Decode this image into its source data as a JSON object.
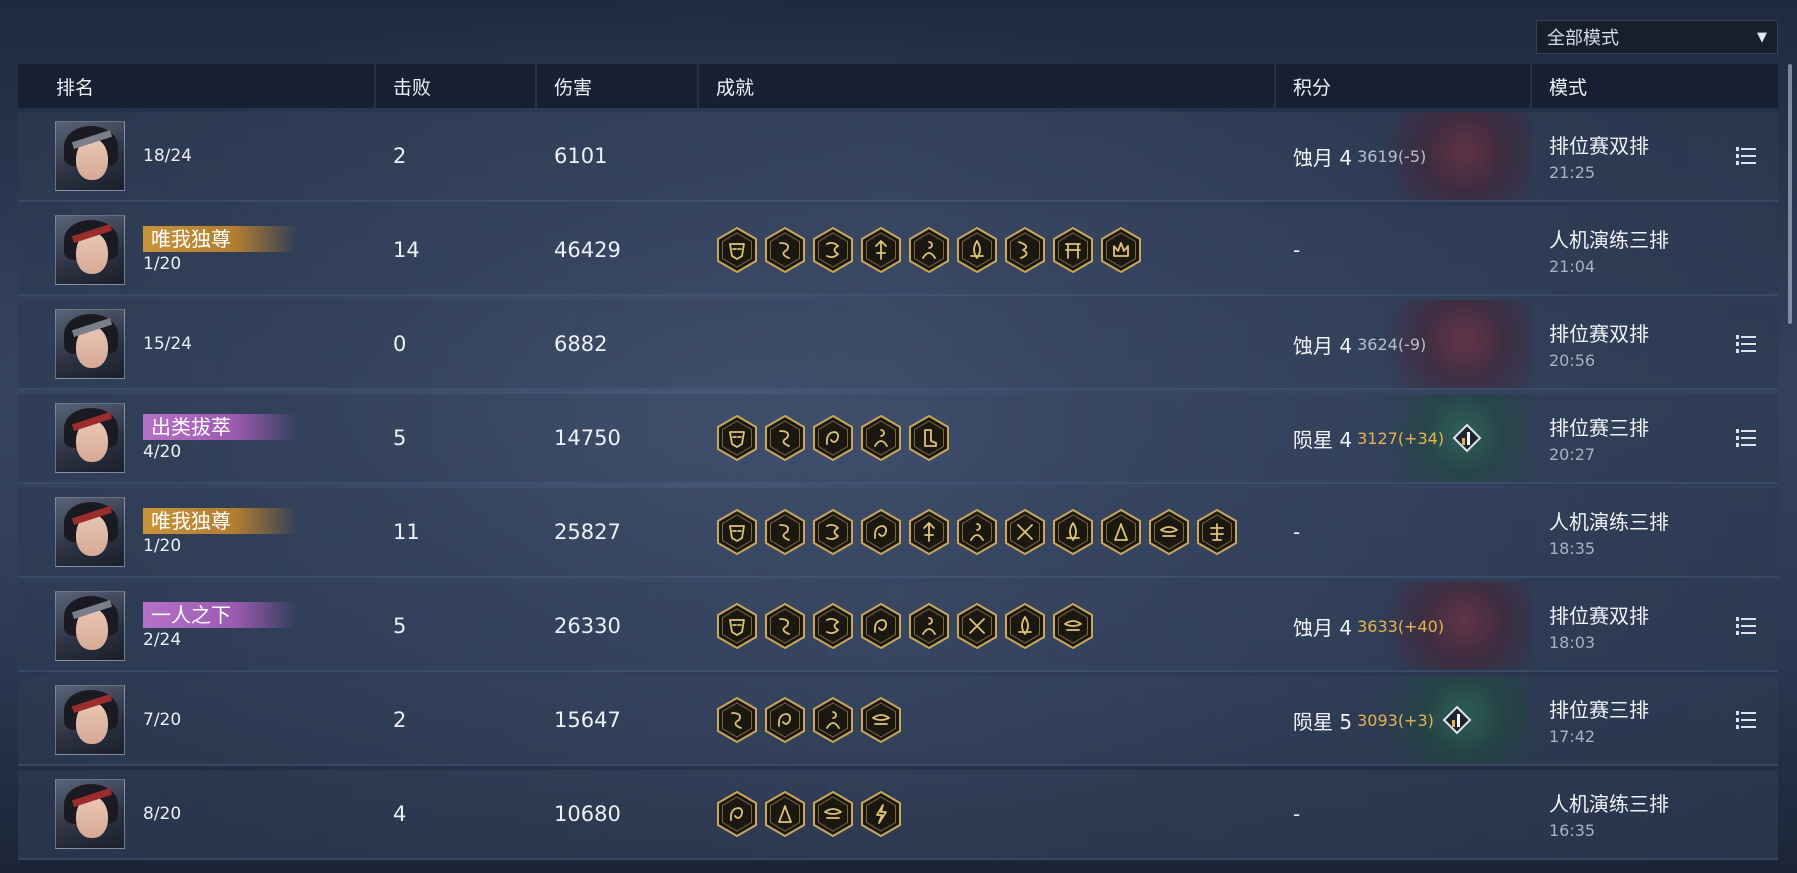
{
  "mode_filter": {
    "selected": "全部模式"
  },
  "headers": {
    "rank": "排名",
    "kills": "击败",
    "damage": "伤害",
    "achievements": "成就",
    "score": "积分",
    "mode": "模式"
  },
  "rows": [
    {
      "avatar": "male",
      "title": "",
      "title_color": "",
      "rank": "18/24",
      "kills": "2",
      "damage": "6101",
      "achievements": [],
      "score_tier": "蚀月 4",
      "score_value": "3619(-5)",
      "score_up": false,
      "score_theme": "red",
      "rank_icon": false,
      "mode_name": "排位赛双排",
      "mode_time": "21:25",
      "has_menu": true
    },
    {
      "avatar": "female",
      "title": "唯我独尊",
      "title_color": "gold",
      "rank": "1/20",
      "kills": "14",
      "damage": "46429",
      "achievements": [
        "mask-icon",
        "snake-icon",
        "dragon-icon",
        "spear-icon",
        "monk-icon",
        "fire-icon",
        "serpent-icon",
        "gate-icon",
        "crown-icon"
      ],
      "score_tier": "-",
      "score_value": "",
      "score_up": false,
      "score_theme": "",
      "rank_icon": false,
      "mode_name": "人机演练三排",
      "mode_time": "21:04",
      "has_menu": false
    },
    {
      "avatar": "male",
      "title": "",
      "title_color": "",
      "rank": "15/24",
      "kills": "0",
      "damage": "6882",
      "achievements": [],
      "score_tier": "蚀月 4",
      "score_value": "3624(-9)",
      "score_up": false,
      "score_theme": "red",
      "rank_icon": false,
      "mode_name": "排位赛双排",
      "mode_time": "20:56",
      "has_menu": true
    },
    {
      "avatar": "female",
      "title": "出类拔萃",
      "title_color": "purple",
      "rank": "4/20",
      "kills": "5",
      "damage": "14750",
      "achievements": [
        "mask-icon",
        "snake-icon",
        "swirl-icon",
        "monk-icon",
        "boot-icon"
      ],
      "score_tier": "陨星 4",
      "score_value": "3127(+34)",
      "score_up": true,
      "score_theme": "green",
      "rank_icon": true,
      "mode_name": "排位赛三排",
      "mode_time": "20:27",
      "has_menu": true
    },
    {
      "avatar": "female",
      "title": "唯我独尊",
      "title_color": "gold",
      "rank": "1/20",
      "kills": "11",
      "damage": "25827",
      "achievements": [
        "mask-icon",
        "snake-icon",
        "dragon-icon",
        "swirl-icon",
        "spear-icon",
        "monk-icon",
        "cross-icon",
        "fire-icon",
        "flame-icon",
        "wing-icon",
        "bug-icon"
      ],
      "score_tier": "-",
      "score_value": "",
      "score_up": false,
      "score_theme": "",
      "rank_icon": false,
      "mode_name": "人机演练三排",
      "mode_time": "18:35",
      "has_menu": false
    },
    {
      "avatar": "male",
      "title": "一人之下",
      "title_color": "purple",
      "rank": "2/24",
      "kills": "5",
      "damage": "26330",
      "achievements": [
        "mask-icon",
        "snake-icon",
        "dragon-icon",
        "swirl-icon",
        "monk-icon",
        "cross-icon",
        "fire-icon",
        "wing-icon"
      ],
      "score_tier": "蚀月 4",
      "score_value": "3633(+40)",
      "score_up": true,
      "score_theme": "red",
      "rank_icon": false,
      "mode_name": "排位赛双排",
      "mode_time": "18:03",
      "has_menu": true
    },
    {
      "avatar": "female",
      "title": "",
      "title_color": "",
      "rank": "7/20",
      "kills": "2",
      "damage": "15647",
      "achievements": [
        "snake-icon",
        "swirl-icon",
        "monk-icon",
        "wing-icon"
      ],
      "score_tier": "陨星 5",
      "score_value": "3093(+3)",
      "score_up": true,
      "score_theme": "green",
      "rank_icon": true,
      "mode_name": "排位赛三排",
      "mode_time": "17:42",
      "has_menu": true
    },
    {
      "avatar": "female",
      "title": "",
      "title_color": "",
      "rank": "8/20",
      "kills": "4",
      "damage": "10680",
      "achievements": [
        "swirl-icon",
        "flame-icon",
        "wing-icon",
        "bolt-icon"
      ],
      "score_tier": "-",
      "score_value": "",
      "score_up": false,
      "score_theme": "",
      "rank_icon": false,
      "mode_name": "人机演练三排",
      "mode_time": "16:35",
      "has_menu": false
    }
  ]
}
